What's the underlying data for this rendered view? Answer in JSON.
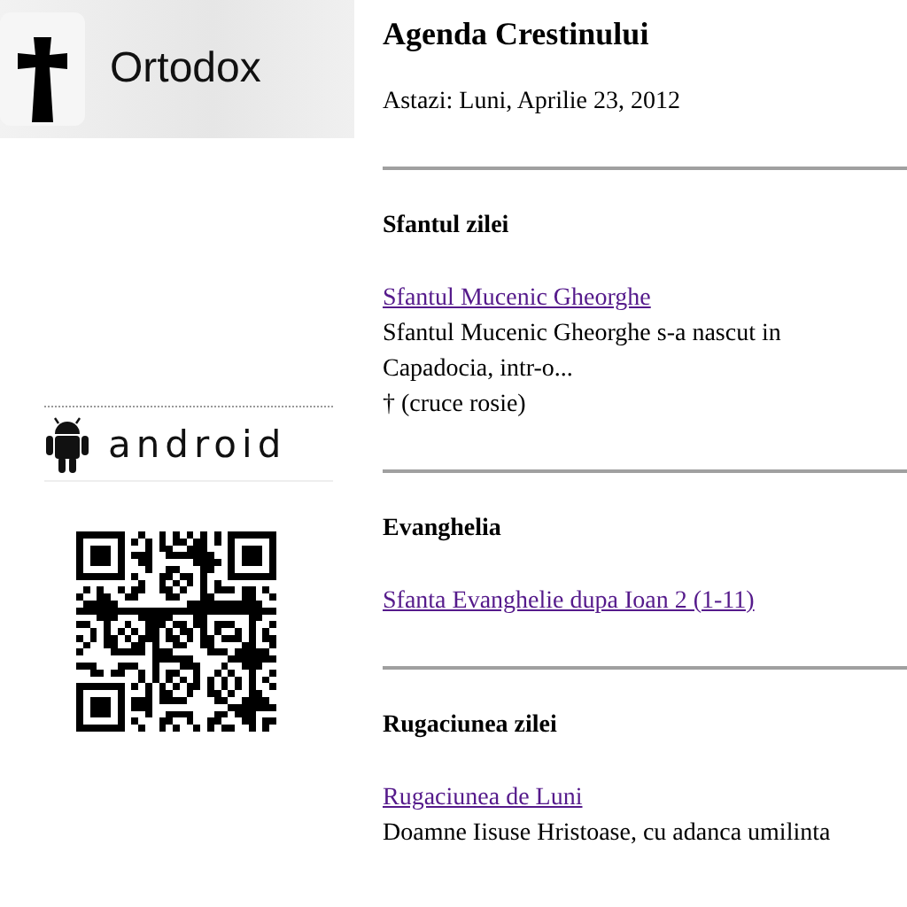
{
  "logo": {
    "text": "Ortodox"
  },
  "android_banner": {
    "text": "android"
  },
  "page": {
    "title": "Agenda Crestinului",
    "date": "Astazi: Luni, Aprilie 23, 2012"
  },
  "sections": [
    {
      "heading": "Sfantul zilei",
      "link": "Sfantul Mucenic Gheorghe",
      "description": "Sfantul Mucenic Gheorghe s-a nascut in Capadocia, intr-o...",
      "note": "† (cruce rosie)"
    },
    {
      "heading": "Evanghelia",
      "link": "Sfanta Evanghelie dupa Ioan 2 (1-11)"
    },
    {
      "heading": "Rugaciunea zilei",
      "link": "Rugaciunea de Luni",
      "description": "Doamne Iisuse Hristoase, cu adanca umilinta"
    }
  ]
}
